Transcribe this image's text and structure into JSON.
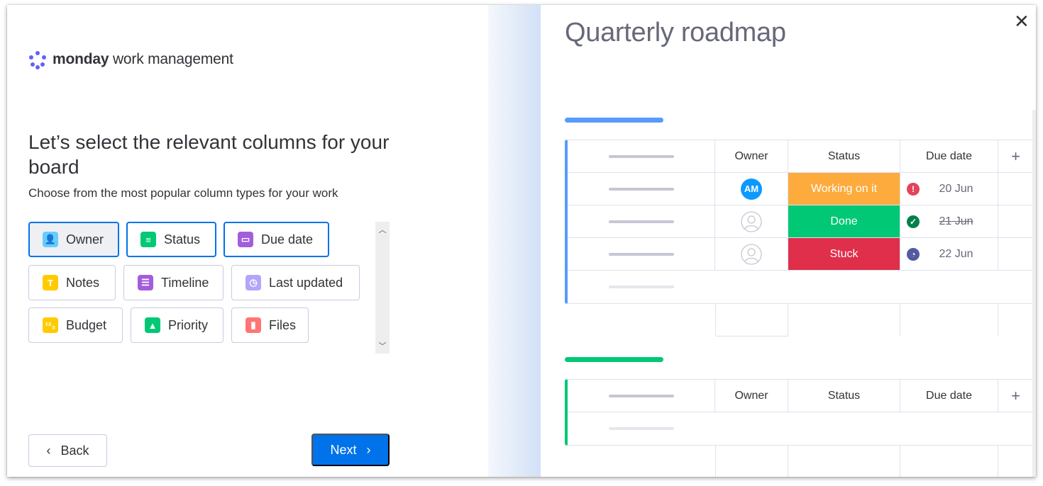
{
  "brand": {
    "bold": "monday",
    "rest": " work management",
    "dot_colors": [
      "#6161ff",
      "#6161ff",
      "#6161ff",
      "#6161ff",
      "#6161ff",
      "#6161ff"
    ]
  },
  "wizard": {
    "title": "Let’s select the relevant columns for your board",
    "subtitle": "Choose from the most popular column types for your work",
    "columns": [
      {
        "label": "Owner",
        "icon": "person-icon",
        "glyph": "👤",
        "color": "#66ccff",
        "selected": true,
        "focused": true
      },
      {
        "label": "Status",
        "icon": "status-icon",
        "glyph": "≡",
        "color": "#00c875",
        "selected": true,
        "focused": false
      },
      {
        "label": "Due date",
        "icon": "calendar-icon",
        "glyph": "▭",
        "color": "#a25ddc",
        "selected": true,
        "focused": false
      },
      {
        "label": "Notes",
        "icon": "text-icon",
        "glyph": "T",
        "color": "#ffcb00",
        "selected": false,
        "focused": false
      },
      {
        "label": "Timeline",
        "icon": "timeline-icon",
        "glyph": "☰",
        "color": "#a25ddc",
        "selected": false,
        "focused": false
      },
      {
        "label": "Last updated",
        "icon": "clock-icon",
        "glyph": "◷",
        "color": "#b5a5fa",
        "selected": false,
        "focused": false
      },
      {
        "label": "Budget",
        "icon": "numbers-icon",
        "glyph": "¹²₃",
        "color": "#ffcb00",
        "selected": false,
        "focused": false
      },
      {
        "label": "Priority",
        "icon": "priority-icon",
        "glyph": "▲",
        "color": "#00c875",
        "selected": false,
        "focused": false
      },
      {
        "label": "Files",
        "icon": "files-icon",
        "glyph": "▮",
        "color": "#ff7575",
        "selected": false,
        "focused": false
      }
    ],
    "back_label": "Back",
    "next_label": "Next",
    "accent": "#0073ea"
  },
  "preview": {
    "title": "Quarterly roadmap",
    "close_glyph": "✕",
    "groups": [
      {
        "color": "#579bfc",
        "headers": {
          "owner": "Owner",
          "status": "Status",
          "due": "Due date",
          "add": "+"
        },
        "rows": [
          {
            "owner": "AM",
            "status": "Working on it",
            "status_color": "#fdab3d",
            "due": "20 Jun",
            "due_icon": "!",
            "due_icon_name": "alert-icon",
            "due_icon_color": "#e2445c",
            "strike": false
          },
          {
            "owner": "",
            "status": "Done",
            "status_color": "#00c875",
            "due": "21 Jun",
            "due_icon": "✓",
            "due_icon_name": "check-icon",
            "due_icon_color": "#037f4c",
            "strike": true
          },
          {
            "owner": "",
            "status": "Stuck",
            "status_color": "#df2f4a",
            "due": "22 Jun",
            "due_icon": "◔",
            "due_icon_name": "clock-icon",
            "due_icon_color": "#5559a0",
            "strike": false
          }
        ]
      },
      {
        "color": "#00c875",
        "headers": {
          "owner": "Owner",
          "status": "Status",
          "due": "Due date",
          "add": "+"
        },
        "rows": []
      }
    ]
  }
}
